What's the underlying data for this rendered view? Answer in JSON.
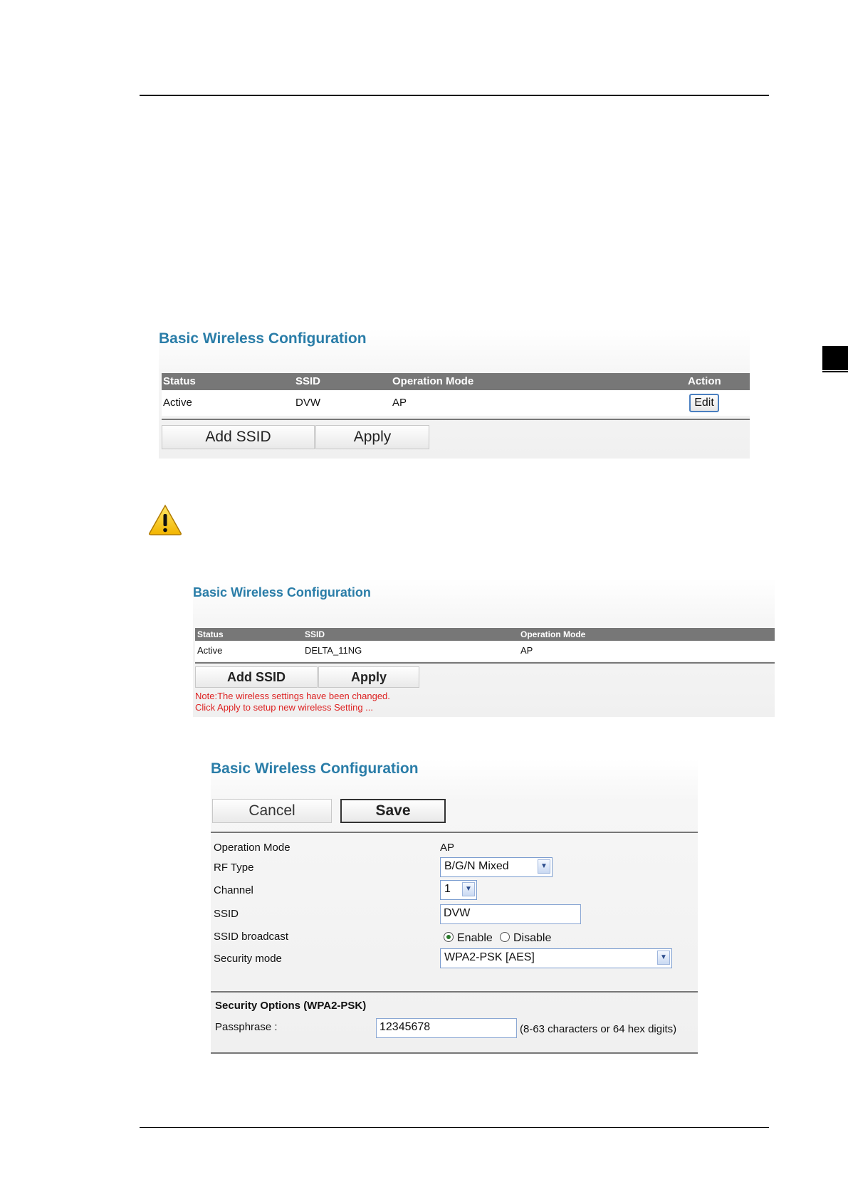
{
  "panel1": {
    "title": "Basic Wireless Configuration",
    "columns": [
      "Status",
      "SSID",
      "Operation Mode",
      "Action"
    ],
    "row": {
      "status": "Active",
      "ssid": "DVW",
      "mode": "AP",
      "action": "Edit"
    },
    "buttons": {
      "add_ssid": "Add SSID",
      "apply": "Apply"
    }
  },
  "panel2": {
    "title": "Basic Wireless Configuration",
    "columns": [
      "Status",
      "SSID",
      "Operation Mode"
    ],
    "row": {
      "status": "Active",
      "ssid": "DELTA_11NG",
      "mode": "AP"
    },
    "buttons": {
      "add_ssid": "Add SSID",
      "apply": "Apply"
    },
    "note_line1": "Note:The wireless settings have been changed.",
    "note_line2": "Click Apply to setup new wireless Setting ..."
  },
  "panel3": {
    "title": "Basic Wireless Configuration",
    "buttons": {
      "cancel": "Cancel",
      "save": "Save"
    },
    "fields": {
      "operation_mode": {
        "label": "Operation Mode",
        "value": "AP"
      },
      "rf_type": {
        "label": "RF Type",
        "value": "B/G/N Mixed"
      },
      "channel": {
        "label": "Channel",
        "value": "1"
      },
      "ssid": {
        "label": "SSID",
        "value": "DVW"
      },
      "ssid_broadcast": {
        "label": "SSID broadcast",
        "enable": "Enable",
        "disable": "Disable",
        "selected": "Enable"
      },
      "security_mode": {
        "label": "Security mode",
        "value": "WPA2-PSK [AES]"
      }
    },
    "security": {
      "heading": "Security Options (WPA2-PSK)",
      "passphrase_label": "Passphrase :",
      "passphrase_value": "12345678",
      "passphrase_hint": "(8-63 characters or 64 hex digits)"
    }
  },
  "colors": {
    "title_blue": "#2a7da8",
    "header_gray": "#777777",
    "note_red": "#dd2222"
  },
  "icons": [
    "warning-icon",
    "chevron-down-icon"
  ]
}
